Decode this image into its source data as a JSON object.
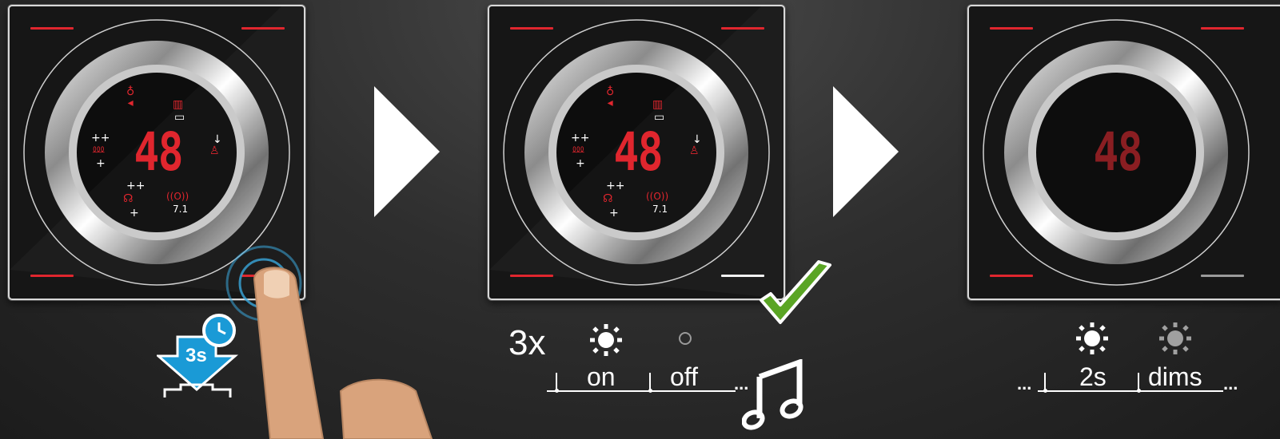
{
  "display_value": "48",
  "step1": {
    "hold_badge": "3s",
    "surround_label": "7.1",
    "plus_plus": "++",
    "plus": "+"
  },
  "step2": {
    "repeat_count": "3x",
    "on_label": "on",
    "off_label": "off",
    "ellipsis": "...",
    "surround_label": "7.1"
  },
  "step3": {
    "time_label": "2s",
    "dims_label": "dims",
    "ellipsis_left": "...",
    "ellipsis_right": "..."
  },
  "colors": {
    "accent_red": "#e0262e",
    "check_green": "#5aa524",
    "clock_blue": "#1a9ad6",
    "finger": "#d9a37c"
  }
}
